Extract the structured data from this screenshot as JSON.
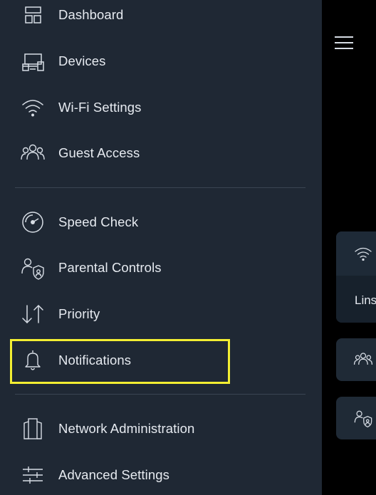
{
  "menu": {
    "items": [
      {
        "label": "Dashboard",
        "icon": "dashboard-icon"
      },
      {
        "label": "Devices",
        "icon": "devices-icon"
      },
      {
        "label": "Wi-Fi Settings",
        "icon": "wifi-icon"
      },
      {
        "label": "Guest Access",
        "icon": "guest-access-icon"
      },
      {
        "label": "Speed Check",
        "icon": "speed-check-icon"
      },
      {
        "label": "Parental Controls",
        "icon": "parental-controls-icon"
      },
      {
        "label": "Priority",
        "icon": "priority-icon"
      },
      {
        "label": "Notifications",
        "icon": "bell-icon"
      },
      {
        "label": "Network Administration",
        "icon": "network-admin-icon"
      },
      {
        "label": "Advanced Settings",
        "icon": "sliders-icon"
      }
    ],
    "highlighted_item": "Notifications"
  },
  "main": {
    "wifi_card_text": "Lins"
  },
  "colors": {
    "drawer_bg": "#1f2834",
    "page_bg": "#000000",
    "highlight": "#f2ee32",
    "text": "#e6eaf0",
    "icon": "#d7dde5"
  }
}
